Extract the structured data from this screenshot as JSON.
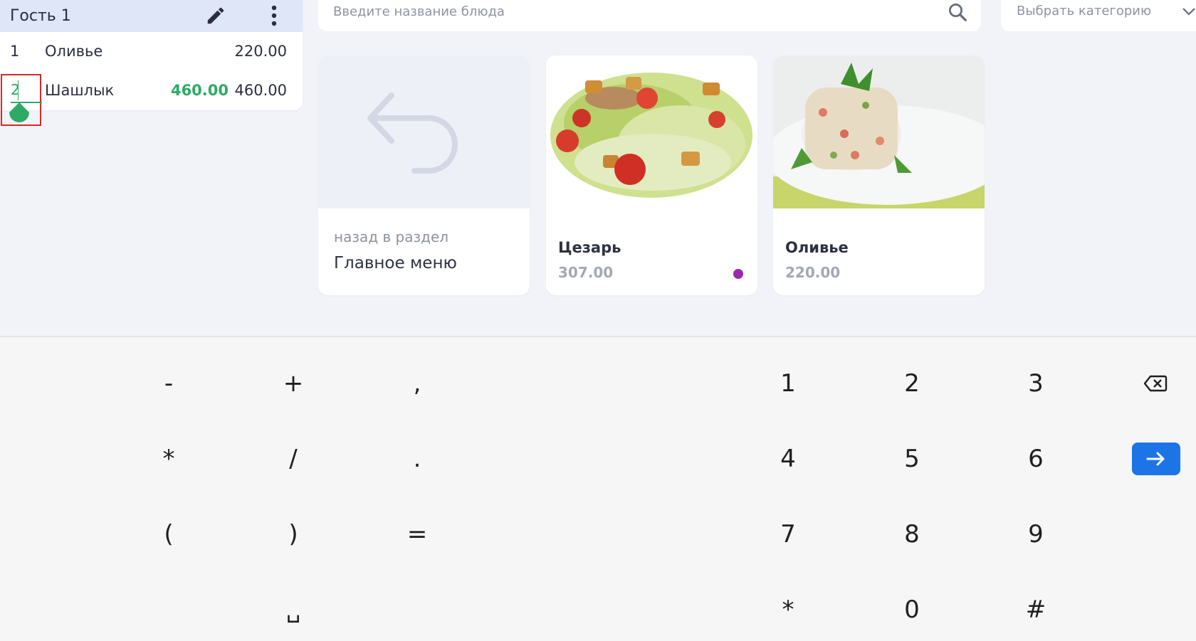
{
  "order": {
    "guest_title": "Гость 1",
    "items": [
      {
        "qty": "1",
        "name": "Оливье",
        "sum": "220.00"
      },
      {
        "qty": "2",
        "name": "Шашлык",
        "new_price": "460.00",
        "sum": "460.00"
      }
    ],
    "icons": {
      "edit": "pencil-icon",
      "more": "more-vertical-icon",
      "handle": "text-cursor-handle"
    }
  },
  "search": {
    "placeholder": "Введите название блюда",
    "value": "",
    "icon": "search-icon"
  },
  "category": {
    "label": "Выбрать категорию",
    "icon": "chevron-down-icon"
  },
  "cards": {
    "back": {
      "subtitle": "назад в раздел",
      "title": "Главное меню",
      "icon": "return-arrow-icon"
    },
    "products": [
      {
        "name": "Цезарь",
        "price": "307.00",
        "has_dot": true,
        "dot_color": "#9c27b0",
        "image": "caesar-salad-image"
      },
      {
        "name": "Оливье",
        "price": "220.00",
        "has_dot": false,
        "image": "olivier-salad-image"
      }
    ]
  },
  "keyboard": {
    "left_rows": [
      [
        "-",
        "+",
        ","
      ],
      [
        "*",
        "/",
        "."
      ],
      [
        "(",
        ")",
        "="
      ],
      [
        "",
        "␣",
        ""
      ]
    ],
    "right_rows": [
      [
        "1",
        "2",
        "3"
      ],
      [
        "4",
        "5",
        "6"
      ],
      [
        "7",
        "8",
        "9"
      ],
      [
        "*",
        "0",
        "#"
      ]
    ],
    "backspace_icon": "backspace-icon",
    "enter_icon": "arrow-right-icon"
  },
  "colors": {
    "accent_blue": "#1d74e7",
    "header_bg": "#dfe6f8",
    "price_green": "#2eaa66",
    "highlight_red": "#d62828"
  }
}
